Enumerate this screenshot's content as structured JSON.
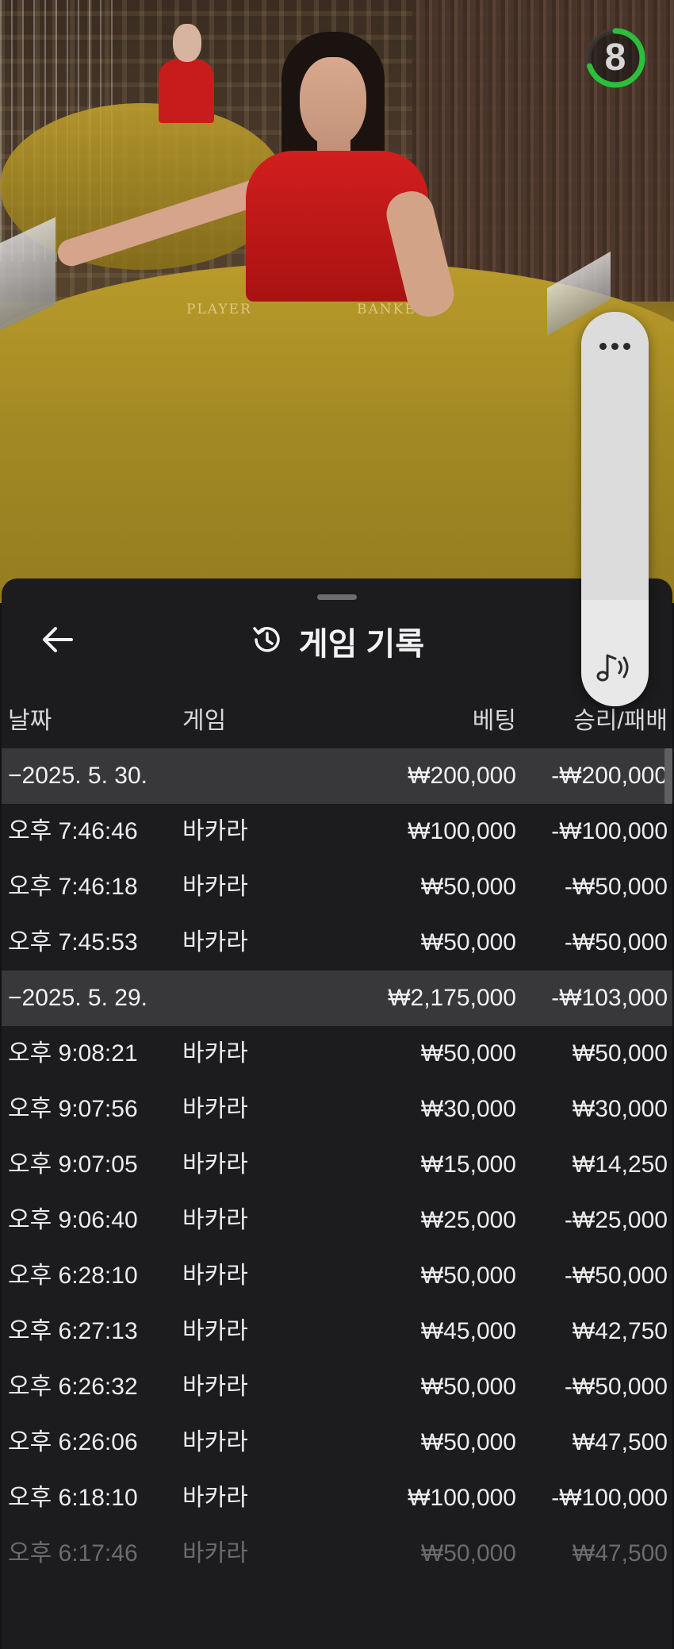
{
  "video": {
    "countdown": "8",
    "countdown_fraction": 0.7,
    "table_labels": [
      "PLAYER",
      "BANKER"
    ],
    "accent_color": "#2bbf3a"
  },
  "sheet": {
    "title": "게임 기록",
    "back_icon": "arrow-left-icon",
    "title_icon": "history-icon"
  },
  "table": {
    "headers": {
      "date": "날짜",
      "game": "게임",
      "bet": "베팅",
      "winloss": "승리/패배"
    },
    "groups": [
      {
        "date": "−2025. 5. 30.",
        "bet": "₩200,000",
        "winloss": "-₩200,000",
        "rows": [
          {
            "time": "오후 7:46:46",
            "game": "바카라",
            "bet": "₩100,000",
            "winloss": "-₩100,000"
          },
          {
            "time": "오후 7:46:18",
            "game": "바카라",
            "bet": "₩50,000",
            "winloss": "-₩50,000"
          },
          {
            "time": "오후 7:45:53",
            "game": "바카라",
            "bet": "₩50,000",
            "winloss": "-₩50,000"
          }
        ]
      },
      {
        "date": "−2025. 5. 29.",
        "bet": "₩2,175,000",
        "winloss": "-₩103,000",
        "rows": [
          {
            "time": "오후 9:08:21",
            "game": "바카라",
            "bet": "₩50,000",
            "winloss": "₩50,000"
          },
          {
            "time": "오후 9:07:56",
            "game": "바카라",
            "bet": "₩30,000",
            "winloss": "₩30,000"
          },
          {
            "time": "오후 9:07:05",
            "game": "바카라",
            "bet": "₩15,000",
            "winloss": "₩14,250"
          },
          {
            "time": "오후 9:06:40",
            "game": "바카라",
            "bet": "₩25,000",
            "winloss": "-₩25,000"
          },
          {
            "time": "오후 6:28:10",
            "game": "바카라",
            "bet": "₩50,000",
            "winloss": "-₩50,000"
          },
          {
            "time": "오후 6:27:13",
            "game": "바카라",
            "bet": "₩45,000",
            "winloss": "₩42,750"
          },
          {
            "time": "오후 6:26:32",
            "game": "바카라",
            "bet": "₩50,000",
            "winloss": "-₩50,000"
          },
          {
            "time": "오후 6:26:06",
            "game": "바카라",
            "bet": "₩50,000",
            "winloss": "₩47,500"
          },
          {
            "time": "오후 6:18:10",
            "game": "바카라",
            "bet": "₩100,000",
            "winloss": "-₩100,000"
          },
          {
            "time": "오후 6:17:46",
            "game": "바카라",
            "bet": "₩50,000",
            "winloss": "₩47,500"
          }
        ]
      }
    ]
  },
  "controls": {
    "more_icon": "more-horizontal-icon",
    "sound_icon": "music-sound-icon",
    "volume_fraction": 0.27
  }
}
